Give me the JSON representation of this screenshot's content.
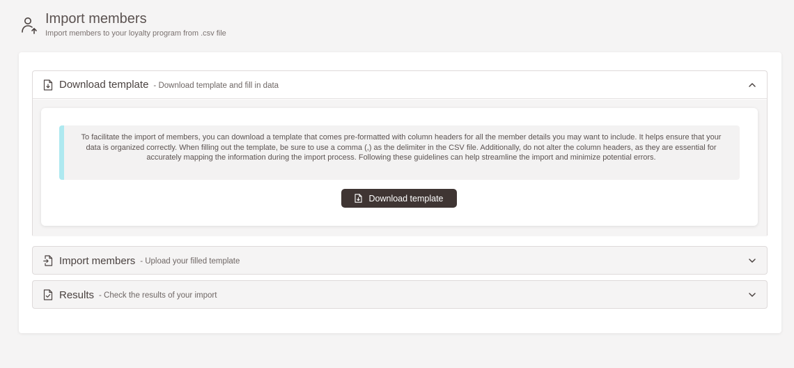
{
  "header": {
    "title": "Import members",
    "subtitle": "Import members to your loyalty program from .csv file",
    "icon": "user-upload-icon"
  },
  "sections": [
    {
      "title": "Download template",
      "description": "- Download template and fill in data",
      "icon": "file-download-icon",
      "expanded": true,
      "callout_text": "To facilitate the import of members, you can download a template that comes pre-formatted with column headers for all the member details you may want to include. It helps ensure that your data is organized correctly. When filling out the template, be sure to use a comma (,) as the delimiter in the CSV file. Additionally, do not alter the column headers, as they are essential for accurately mapping the information during the import process. Following these guidelines can help streamline the import and minimize potential errors.",
      "button_label": "Download template"
    },
    {
      "title": "Import members",
      "description": "- Upload your filled template",
      "icon": "file-import-icon",
      "expanded": false
    },
    {
      "title": "Results",
      "description": "- Check the results of your import",
      "icon": "file-check-icon",
      "expanded": false
    }
  ],
  "colors": {
    "accent_callout": "#aee9f0",
    "button_bg": "#3f3533",
    "page_bg": "#f5f4f4"
  }
}
